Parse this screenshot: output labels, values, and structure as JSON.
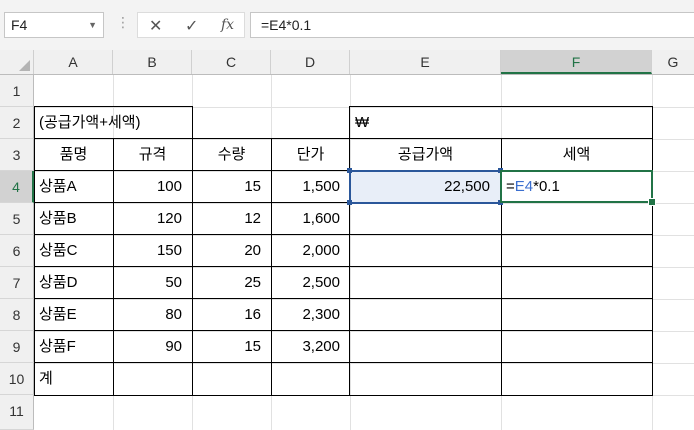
{
  "formula_bar": {
    "name_box": "F4",
    "cancel_icon": "✕",
    "enter_icon": "✓",
    "fx_icon": "fx",
    "formula": "=E4*0.1"
  },
  "columns": [
    "A",
    "B",
    "C",
    "D",
    "E",
    "F",
    "G"
  ],
  "rows": [
    "1",
    "2",
    "3",
    "4",
    "5",
    "6",
    "7",
    "8",
    "9",
    "10",
    "11"
  ],
  "sheet": {
    "title": "(공급가액+세액)",
    "currency": "₩",
    "headers": [
      "품명",
      "규격",
      "수량",
      "단가",
      "공급가액",
      "세액"
    ],
    "items": [
      [
        "상품A",
        "100",
        "15",
        "1,500"
      ],
      [
        "상품B",
        "120",
        "12",
        "1,600"
      ],
      [
        "상품C",
        "150",
        "20",
        "2,000"
      ],
      [
        "상품D",
        "50",
        "25",
        "2,500"
      ],
      [
        "상품E",
        "80",
        "16",
        "2,300"
      ],
      [
        "상품F",
        "90",
        "15",
        "3,200"
      ]
    ],
    "total_label": "계",
    "e4_value": "22,500",
    "f4_prefix": "=",
    "f4_ref": "E4",
    "f4_suffix": "*0.1"
  },
  "colors": {
    "excel_green": "#217346",
    "selection_blue": "#2b579a",
    "ref_blue": "#3b6fcf"
  }
}
